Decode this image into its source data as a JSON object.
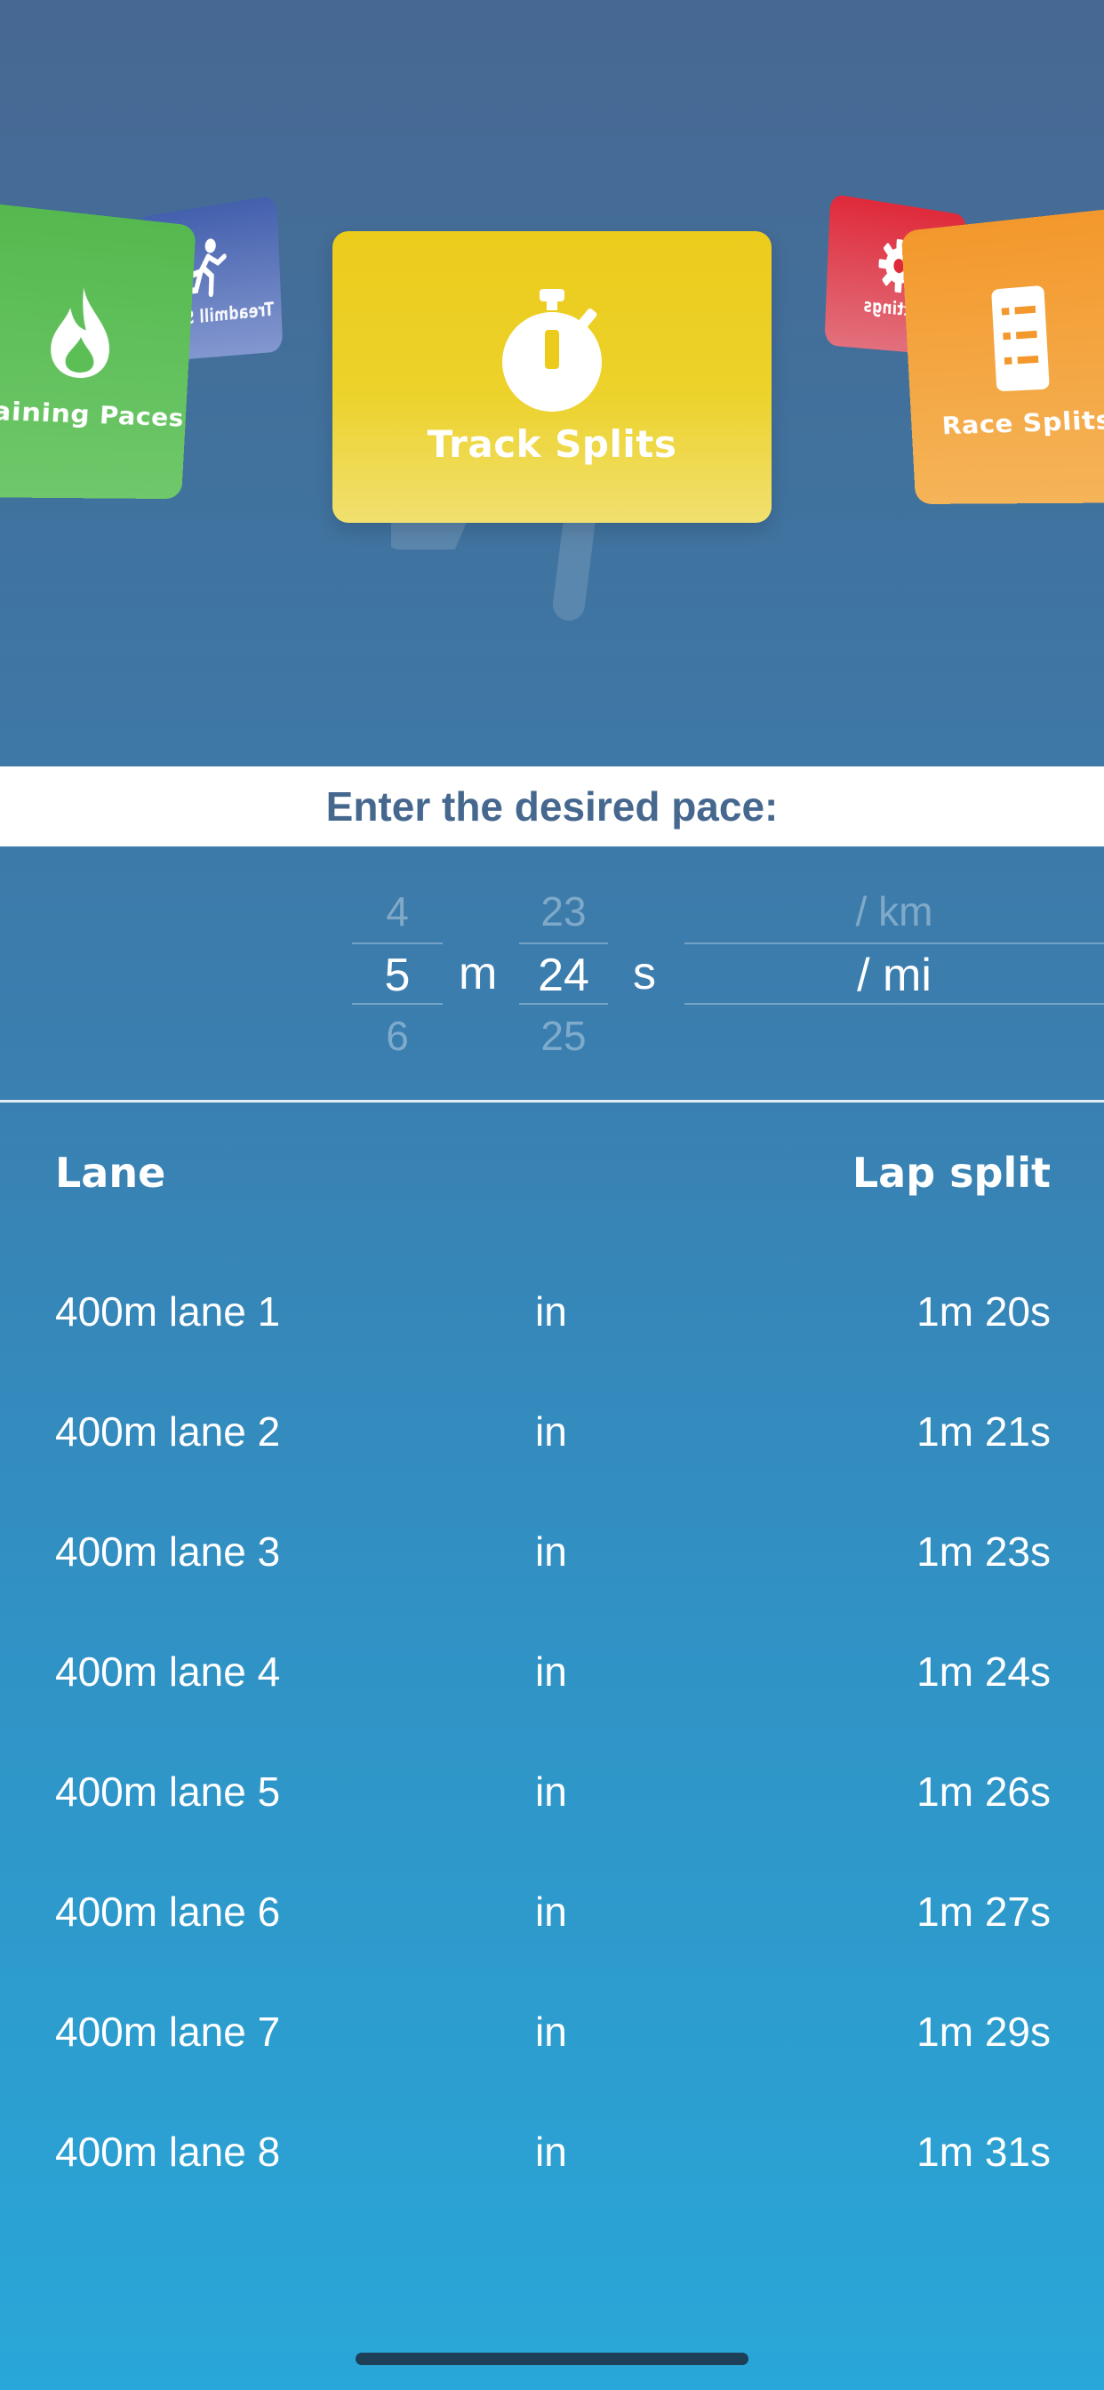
{
  "carousel": {
    "cards": [
      {
        "id": "training",
        "label": "Training Paces",
        "icon": "flame-icon",
        "color": "#5cbf56"
      },
      {
        "id": "treadmill",
        "label": "Treadmill Speed",
        "icon": "runner-icon",
        "color": "#4a63ad"
      },
      {
        "id": "track",
        "label": "Track Splits",
        "icon": "stopwatch-icon",
        "color": "#eccb1c"
      },
      {
        "id": "settings",
        "label": "Settings",
        "icon": "gear-icon",
        "color": "#df2a3a"
      },
      {
        "id": "race",
        "label": "Race Splits",
        "icon": "checklist-icon",
        "color": "#f3982c"
      }
    ]
  },
  "prompt": "Enter the desired pace:",
  "picker": {
    "minutes": {
      "prev": "4",
      "selected": "5",
      "next": "6"
    },
    "minutes_label": "m",
    "seconds": {
      "prev": "23",
      "selected": "24",
      "next": "25"
    },
    "seconds_label": "s",
    "unit": {
      "prev": "/ km",
      "selected": "/ mi"
    }
  },
  "table": {
    "header_lane": "Lane",
    "header_split": "Lap split",
    "rows": [
      {
        "lane": "400m lane 1",
        "unit": "in",
        "split": "1m 20s"
      },
      {
        "lane": "400m lane 2",
        "unit": "in",
        "split": "1m 21s"
      },
      {
        "lane": "400m lane 3",
        "unit": "in",
        "split": "1m 23s"
      },
      {
        "lane": "400m lane 4",
        "unit": "in",
        "split": "1m 24s"
      },
      {
        "lane": "400m lane 5",
        "unit": "in",
        "split": "1m 26s"
      },
      {
        "lane": "400m lane 6",
        "unit": "in",
        "split": "1m 27s"
      },
      {
        "lane": "400m lane 7",
        "unit": "in",
        "split": "1m 29s"
      },
      {
        "lane": "400m lane 8",
        "unit": "in",
        "split": "1m 31s"
      }
    ]
  }
}
